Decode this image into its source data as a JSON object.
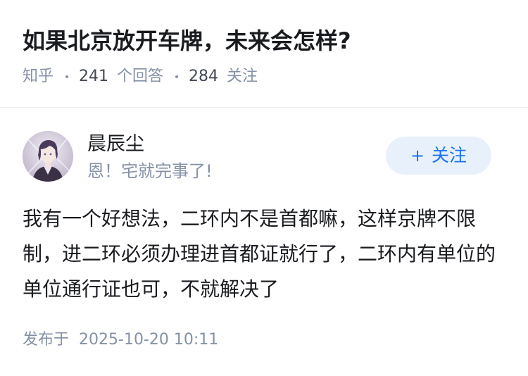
{
  "question": {
    "title": "如果北京放开车牌，未来会怎样?",
    "source": "知乎",
    "answer_count": "241",
    "answer_label": "个回答",
    "follower_count": "284",
    "follower_label": "关注"
  },
  "author": {
    "name": "晨辰尘",
    "headline": "恩！宅就完事了!",
    "avatar_icon": "avatar-portrait-icon"
  },
  "follow_button": {
    "plus": "+",
    "label": "关注"
  },
  "answer": {
    "content": "我有一个好想法，二环内不是首都嘛，这样京牌不限制，进二环必须办理进首都证就行了，二环内有单位的单位通行证也可，不就解决了",
    "time_prefix": "发布于",
    "time": "2025-10-20 10:11"
  },
  "colors": {
    "accent": "#1772f6",
    "follow_bg": "#e8f1fb",
    "muted": "#8491a5",
    "text": "#191b1f"
  }
}
